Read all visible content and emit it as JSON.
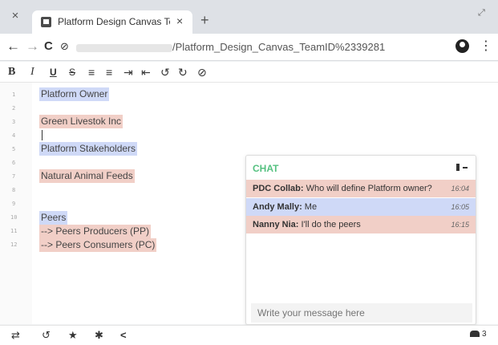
{
  "browser": {
    "tab_title": "Platform Design Canvas TeamI",
    "tab_close": "×",
    "new_tab": "+",
    "window_close": "×",
    "restore": "⤢",
    "url_suffix": "/Platform_Design_Canvas_TeamID%2339281",
    "back": "←",
    "forward": "→",
    "reload": "C",
    "site_info": "⊘",
    "menu": "⋮"
  },
  "toolbar": {
    "bold": "B",
    "italic": "I",
    "underline": "U",
    "strike": "S",
    "ordered_list": "≡",
    "bullet_list": "≡",
    "indent": "⇥",
    "outdent": "⇤",
    "undo": "↺",
    "redo": "↻",
    "hide": "⊘"
  },
  "editor": {
    "line_numbers": [
      "1",
      "2",
      "3",
      "4",
      "5",
      "6",
      "7",
      "8",
      "9",
      "10",
      "11",
      "12"
    ],
    "lines": [
      {
        "text": "Platform Owner",
        "highlight": "blue"
      },
      {
        "text": "Green Livestok Inc",
        "highlight": "pink"
      },
      {
        "text": "Platform Stakeholders",
        "highlight": "blue"
      },
      {
        "text": "Natural Animal Feeds",
        "highlight": "pink"
      },
      {
        "text": "Peers",
        "highlight": "blue"
      },
      {
        "text": "--> Peers Producers (PP)",
        "highlight": "pink"
      },
      {
        "text": "--> Peers Consumers (PC)",
        "highlight": "pink"
      }
    ]
  },
  "chat": {
    "title": "CHAT",
    "messages": [
      {
        "author": "PDC Collab:",
        "text": " Who will define Platform owner?",
        "time": "16:04",
        "color": "#f1cfc7"
      },
      {
        "author": "Andy Mally:",
        "text": " Me",
        "time": "16:05",
        "color": "#cfd9f7"
      },
      {
        "author": "Nanny Nia:",
        "text": " I'll do the peers",
        "time": "16:15",
        "color": "#f1cfc7"
      }
    ],
    "input_placeholder": "Write your message here"
  },
  "bottombar": {
    "swap": "⇄",
    "history": "↺",
    "star": "★",
    "settings": "✱",
    "share": "<",
    "user_count": "3"
  }
}
